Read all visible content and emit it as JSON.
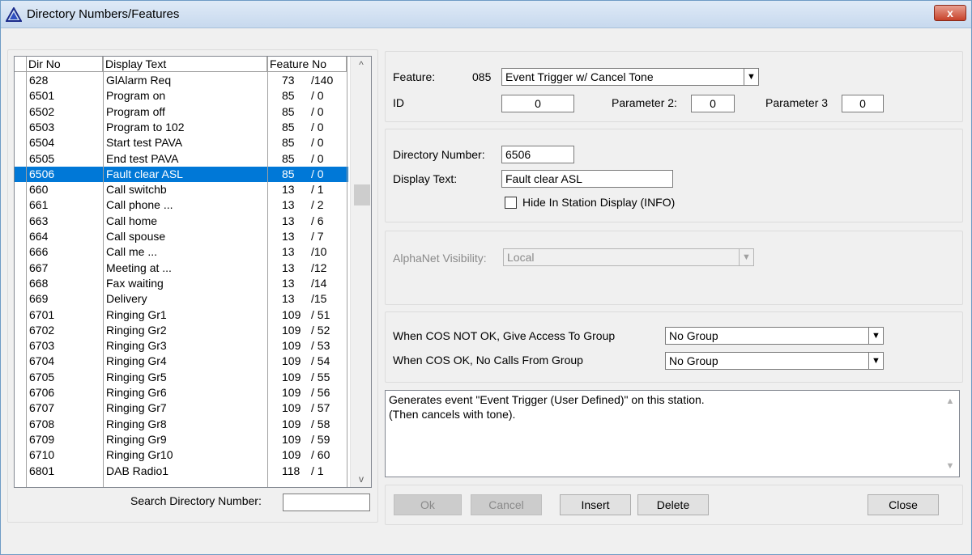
{
  "window": {
    "title": "Directory Numbers/Features",
    "close_label": "x"
  },
  "list": {
    "columns": [
      "Dir No",
      "Display Text",
      "Feature No"
    ],
    "rows": [
      {
        "dir": "628",
        "text": "GlAlarm Req",
        "feat": "73",
        "sub": "/140"
      },
      {
        "dir": "6501",
        "text": "Program on",
        "feat": "85",
        "sub": "/ 0"
      },
      {
        "dir": "6502",
        "text": "Program off",
        "feat": "85",
        "sub": "/ 0"
      },
      {
        "dir": "6503",
        "text": "Program to 102",
        "feat": "85",
        "sub": "/ 0"
      },
      {
        "dir": "6504",
        "text": "Start test PAVA",
        "feat": "85",
        "sub": "/ 0"
      },
      {
        "dir": "6505",
        "text": "End test PAVA",
        "feat": "85",
        "sub": "/ 0"
      },
      {
        "dir": "6506",
        "text": "Fault clear ASL",
        "feat": "85",
        "sub": "/ 0",
        "selected": true
      },
      {
        "dir": "660",
        "text": "Call switchb",
        "feat": "13",
        "sub": "/ 1"
      },
      {
        "dir": "661",
        "text": "Call phone ...",
        "feat": "13",
        "sub": "/ 2"
      },
      {
        "dir": "663",
        "text": "Call home",
        "feat": "13",
        "sub": "/ 6"
      },
      {
        "dir": "664",
        "text": "Call spouse",
        "feat": "13",
        "sub": "/ 7"
      },
      {
        "dir": "666",
        "text": "Call me ...",
        "feat": "13",
        "sub": "/10"
      },
      {
        "dir": "667",
        "text": "Meeting at ...",
        "feat": "13",
        "sub": "/12"
      },
      {
        "dir": "668",
        "text": "Fax waiting",
        "feat": "13",
        "sub": "/14"
      },
      {
        "dir": "669",
        "text": "Delivery",
        "feat": "13",
        "sub": "/15"
      },
      {
        "dir": "6701",
        "text": "Ringing Gr1",
        "feat": "109",
        "sub": "/ 51"
      },
      {
        "dir": "6702",
        "text": "Ringing Gr2",
        "feat": "109",
        "sub": "/ 52"
      },
      {
        "dir": "6703",
        "text": "Ringing Gr3",
        "feat": "109",
        "sub": "/ 53"
      },
      {
        "dir": "6704",
        "text": "Ringing Gr4",
        "feat": "109",
        "sub": "/ 54"
      },
      {
        "dir": "6705",
        "text": "Ringing Gr5",
        "feat": "109",
        "sub": "/ 55"
      },
      {
        "dir": "6706",
        "text": "Ringing Gr6",
        "feat": "109",
        "sub": "/ 56"
      },
      {
        "dir": "6707",
        "text": "Ringing Gr7",
        "feat": "109",
        "sub": "/ 57"
      },
      {
        "dir": "6708",
        "text": "Ringing Gr8",
        "feat": "109",
        "sub": "/ 58"
      },
      {
        "dir": "6709",
        "text": "Ringing Gr9",
        "feat": "109",
        "sub": "/ 59"
      },
      {
        "dir": "6710",
        "text": "Ringing Gr10",
        "feat": "109",
        "sub": "/ 60"
      },
      {
        "dir": "6801",
        "text": "DAB Radio1",
        "feat": "118",
        "sub": "/ 1"
      }
    ],
    "scroll_up": "^",
    "scroll_down": "v"
  },
  "search": {
    "label": "Search Directory Number:",
    "value": ""
  },
  "feature": {
    "label": "Feature:",
    "code": "085",
    "selected": "Event Trigger w/ Cancel Tone",
    "id_label": "ID",
    "id_value": "0",
    "param2_label": "Parameter 2:",
    "param2_value": "0",
    "param3_label": "Parameter 3",
    "param3_value": "0"
  },
  "directory": {
    "number_label": "Directory Number:",
    "number_value": "6506",
    "text_label": "Display Text:",
    "text_value": "Fault clear ASL",
    "hide_label": "Hide In Station Display (INFO)"
  },
  "alphanet": {
    "label": "AlphaNet Visibility:",
    "value": "Local"
  },
  "cos": {
    "not_ok_label": "When COS NOT OK, Give Access To Group",
    "not_ok_value": "No Group",
    "ok_label": "When COS OK, No Calls From Group",
    "ok_value": "No Group"
  },
  "description": {
    "line1": "Generates event \"Event Trigger (User Defined)\" on this station.",
    "line2": "(Then cancels with tone)."
  },
  "buttons": {
    "ok": "Ok",
    "cancel": "Cancel",
    "insert": "Insert",
    "delete": "Delete",
    "close": "Close"
  },
  "colors": {
    "selection": "#0078d7",
    "title_gradient_top": "#dfeaf7"
  }
}
